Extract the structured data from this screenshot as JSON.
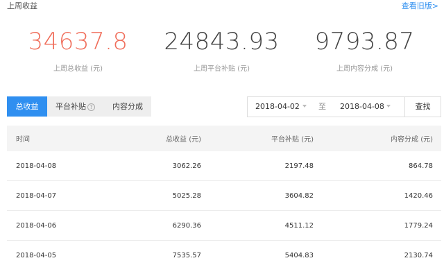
{
  "header": {
    "title": "上周收益",
    "old_version_link": "查看旧版>"
  },
  "stats": [
    {
      "value": "34637.8",
      "label": "上周总收益 (元)"
    },
    {
      "value": "24843.93",
      "label": "上周平台补贴 (元)"
    },
    {
      "value": "9793.87",
      "label": "上周内容分成 (元)"
    }
  ],
  "tabs": [
    {
      "label": "总收益",
      "active": true
    },
    {
      "label": "平台补贴",
      "help_icon": "?"
    },
    {
      "label": "内容分成"
    }
  ],
  "filter": {
    "start_date": "2018-04-02",
    "separator": "至",
    "end_date": "2018-04-08",
    "search_label": "查找"
  },
  "table": {
    "headers": [
      "时间",
      "总收益 (元)",
      "平台补贴 (元)",
      "内容分成 (元)"
    ],
    "rows": [
      [
        "2018-04-08",
        "3062.26",
        "2197.48",
        "864.78"
      ],
      [
        "2018-04-07",
        "5025.28",
        "3604.82",
        "1420.46"
      ],
      [
        "2018-04-06",
        "6290.36",
        "4511.12",
        "1779.24"
      ],
      [
        "2018-04-05",
        "7535.57",
        "5404.83",
        "2130.74"
      ]
    ]
  },
  "colors": {
    "accent": "#2f8ff0",
    "highlight_value": "#f06e5b"
  }
}
